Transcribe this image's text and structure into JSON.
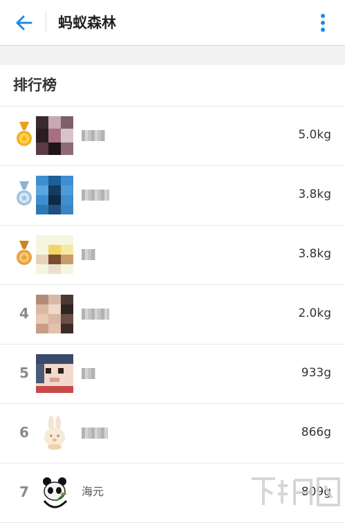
{
  "appbar": {
    "title": "蚂蚁森林",
    "back_icon": "arrow-left-icon",
    "more_icon": "more-vertical-icon",
    "accent_color": "#1e88e5"
  },
  "leaderboard": {
    "title": "排行榜",
    "entries": [
      {
        "rank": "1",
        "medal": "gold",
        "name": "",
        "weight": "5.0kg"
      },
      {
        "rank": "2",
        "medal": "silver",
        "name": "",
        "weight": "3.8kg"
      },
      {
        "rank": "3",
        "medal": "bronze",
        "name": "",
        "weight": "3.8kg"
      },
      {
        "rank": "4",
        "medal": "",
        "name": "",
        "weight": "2.0kg"
      },
      {
        "rank": "5",
        "medal": "",
        "name": "",
        "weight": "933g"
      },
      {
        "rank": "6",
        "medal": "",
        "name": "",
        "weight": "866g"
      },
      {
        "rank": "7",
        "medal": "",
        "name": "海元",
        "weight": "809g"
      }
    ]
  },
  "colors": {
    "gold": "#f2b01e",
    "silver": "#9fc3e0",
    "bronze": "#e3a23b"
  }
}
